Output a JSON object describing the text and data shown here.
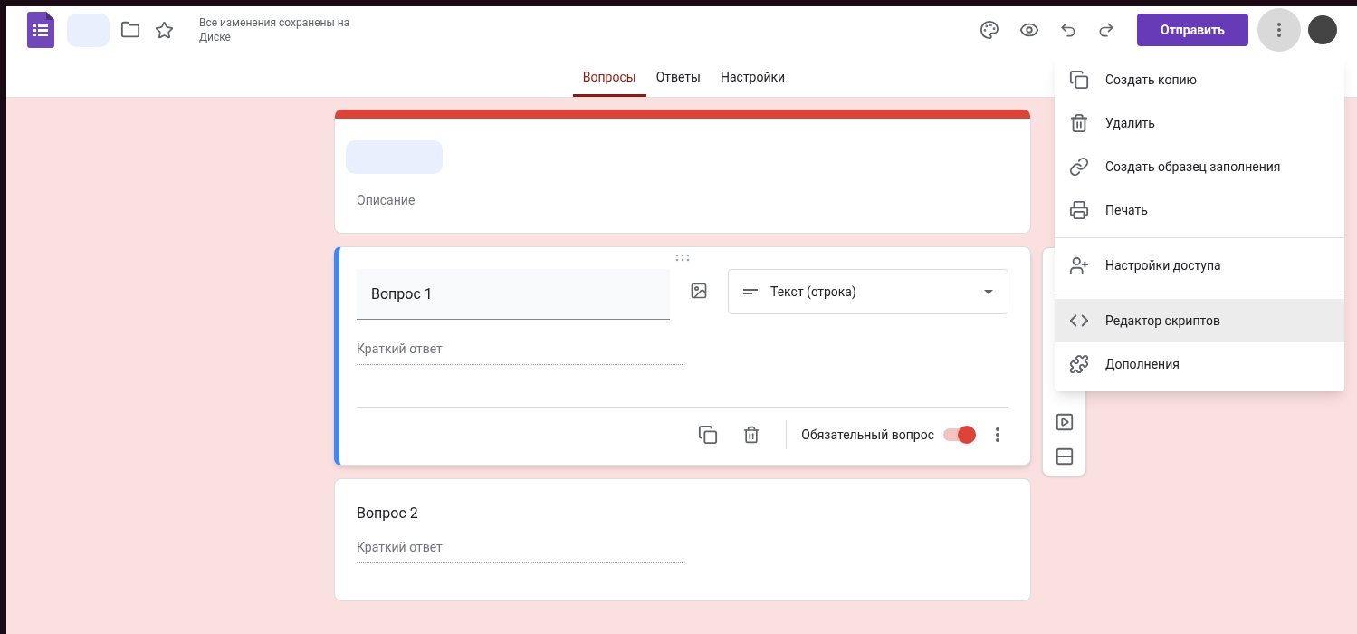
{
  "header": {
    "save_status": "Все изменения сохранены на Диске",
    "send_button": "Отправить",
    "more_button_active": true
  },
  "tabs": [
    {
      "label": "Вопросы",
      "selected": true
    },
    {
      "label": "Ответы",
      "selected": false
    },
    {
      "label": "Настройки",
      "selected": false
    }
  ],
  "form_header": {
    "description_placeholder": "Описание"
  },
  "questions": [
    {
      "title": "Вопрос 1",
      "focused": true,
      "type": "Текст (строка)",
      "answer_placeholder": "Краткий ответ",
      "required_label": "Обязательный вопрос",
      "required": true
    },
    {
      "title": "Вопрос 2",
      "focused": false,
      "answer_placeholder": "Краткий ответ"
    }
  ],
  "menu": {
    "groups": [
      [
        {
          "label": "Создать копию",
          "selected": false
        },
        {
          "label": "Удалить",
          "selected": false
        },
        {
          "label": "Создать образец заполнения",
          "selected": false
        },
        {
          "label": "Печать",
          "selected": false
        }
      ],
      [
        {
          "label": "Настройки доступа",
          "selected": false
        }
      ],
      [
        {
          "label": "Редактор скриптов",
          "selected": true
        },
        {
          "label": "Дополнения",
          "selected": false
        }
      ]
    ]
  }
}
